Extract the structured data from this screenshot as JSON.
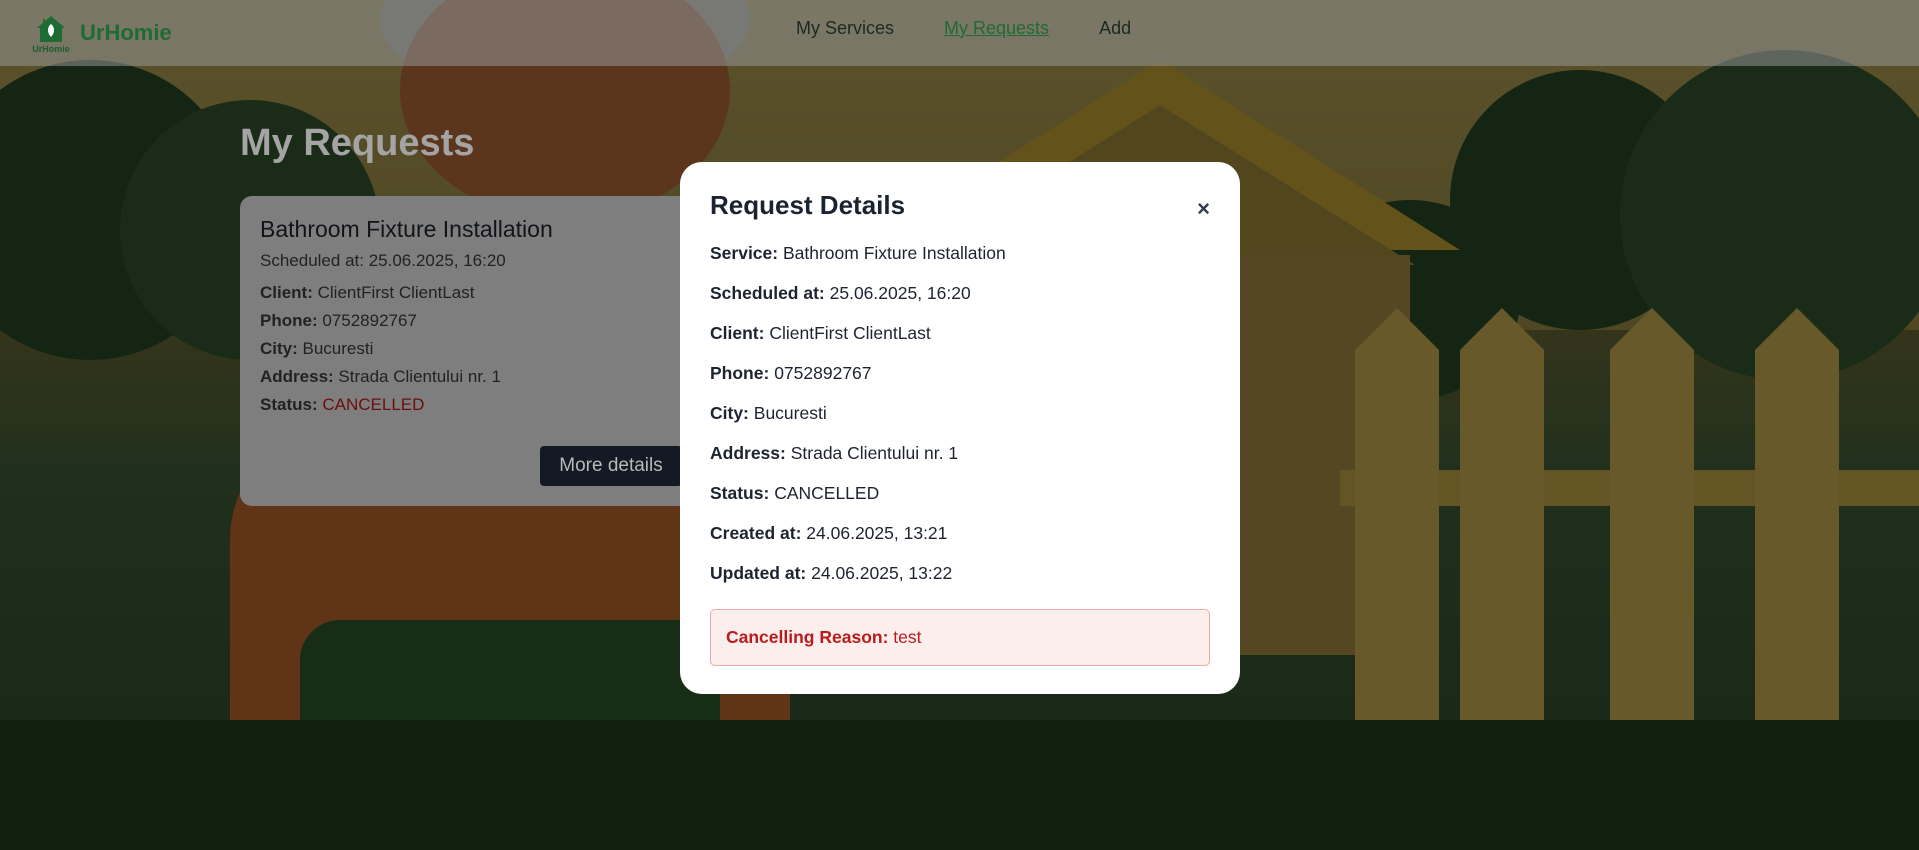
{
  "nav": {
    "brand": "UrHomie",
    "logo_text": "UrHomie",
    "links": [
      "My Services",
      "My Requests",
      "Add"
    ],
    "active_link": "My Requests"
  },
  "page": {
    "title": "My Requests"
  },
  "card": {
    "title": "Bathroom Fixture Installation",
    "scheduled": "Scheduled at: 25.06.2025, 16:20",
    "client_label": "Client:",
    "client": "ClientFirst ClientLast",
    "phone_label": "Phone:",
    "phone": "0752892767",
    "city_label": "City:",
    "city": "Bucuresti",
    "address_label": "Address:",
    "address": "Strada Clientului nr. 1",
    "status_label": "Status:",
    "status": "CANCELLED",
    "more_button": "More details"
  },
  "modal": {
    "title": "Request Details",
    "close": "×",
    "rows": [
      {
        "label": "Service:",
        "value": "Bathroom Fixture Installation"
      },
      {
        "label": "Scheduled at:",
        "value": "25.06.2025, 16:20"
      },
      {
        "label": "Client:",
        "value": "ClientFirst ClientLast"
      },
      {
        "label": "Phone:",
        "value": "0752892767"
      },
      {
        "label": "City:",
        "value": "Bucuresti"
      },
      {
        "label": "Address:",
        "value": "Strada Clientului nr. 1"
      },
      {
        "label": "Status:",
        "value": "CANCELLED"
      },
      {
        "label": "Created at:",
        "value": "24.06.2025, 13:21"
      },
      {
        "label": "Updated at:",
        "value": "24.06.2025, 13:22"
      }
    ],
    "reason_label": "Cancelling Reason:",
    "reason_value": "test"
  },
  "colors": {
    "brand_green": "#1e6b33",
    "danger_red": "#b91c1c",
    "button_dark": "#141a23"
  }
}
